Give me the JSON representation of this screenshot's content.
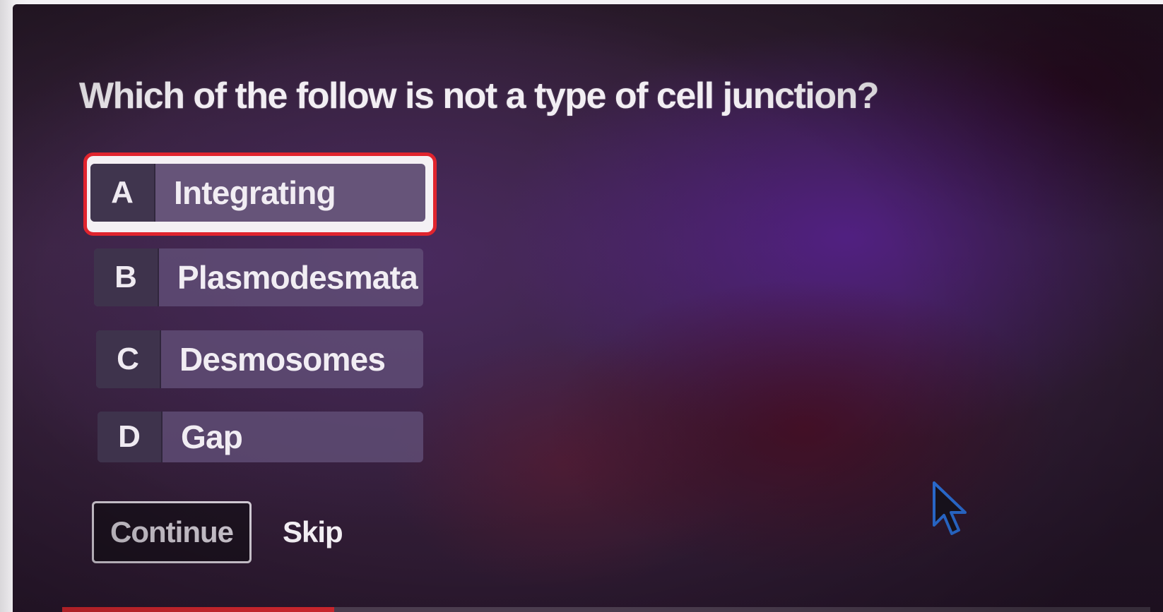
{
  "question": {
    "text": "Which of the follow is not a type of cell junction?"
  },
  "options": [
    {
      "letter": "A",
      "label": "Integrating",
      "selected": true
    },
    {
      "letter": "B",
      "label": "Plasmodesmata",
      "selected": false
    },
    {
      "letter": "C",
      "label": "Desmosomes",
      "selected": false
    },
    {
      "letter": "D",
      "label": "Gap",
      "selected": false
    }
  ],
  "actions": {
    "continue_label": "Continue",
    "skip_label": "Skip"
  },
  "progress": {
    "fraction": 0.25
  },
  "icons": {
    "cursor": "mouse-pointer-icon"
  },
  "colors": {
    "selection_ring": "#e0242e",
    "progress_fill": "#e02a32",
    "cursor_outline": "#2f78e8"
  }
}
